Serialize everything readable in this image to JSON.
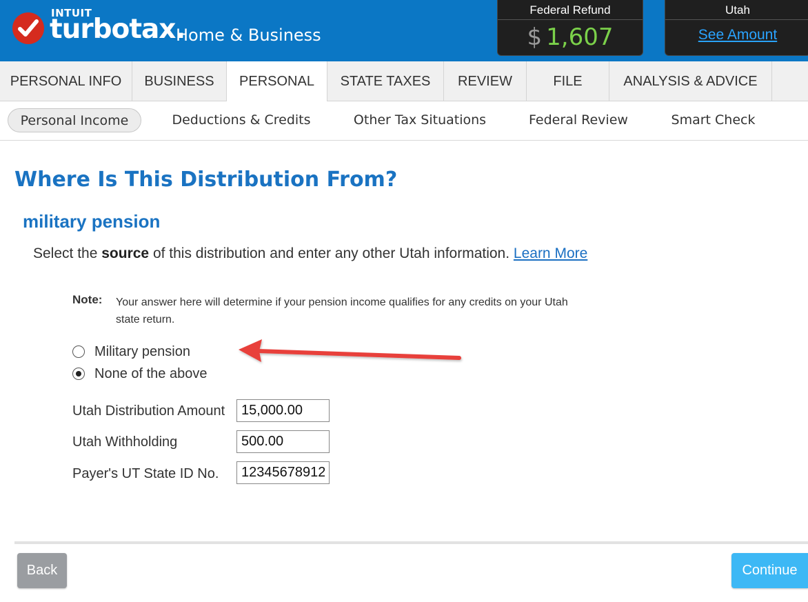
{
  "header": {
    "brand_top": "INTUIT",
    "brand_name": "turbotax.",
    "edition": "Home & Business",
    "federal_refund": {
      "label": "Federal Refund",
      "currency": "$",
      "amount": "1,607"
    },
    "state": {
      "label": "Utah",
      "link": "See Amount"
    }
  },
  "main_nav": {
    "tabs": [
      {
        "label": "PERSONAL INFO",
        "active": false
      },
      {
        "label": "BUSINESS",
        "active": false
      },
      {
        "label": "PERSONAL",
        "active": true
      },
      {
        "label": "STATE TAXES",
        "active": false
      },
      {
        "label": "REVIEW",
        "active": false
      },
      {
        "label": "FILE",
        "active": false
      },
      {
        "label": "ANALYSIS & ADVICE",
        "active": false
      }
    ]
  },
  "sub_nav": {
    "items": [
      {
        "label": "Personal Income",
        "active": true
      },
      {
        "label": "Deductions & Credits",
        "active": false
      },
      {
        "label": "Other Tax Situations",
        "active": false
      },
      {
        "label": "Federal Review",
        "active": false
      },
      {
        "label": "Smart Check",
        "active": false
      }
    ]
  },
  "content": {
    "title": "Where Is This Distribution From?",
    "subtitle": "military pension",
    "instruction_pre": "Select the ",
    "instruction_bold": "source",
    "instruction_post": " of this distribution and enter any other Utah information. ",
    "learn_more": "Learn More",
    "note_label": "Note:",
    "note_text": "Your answer here will determine if your pension income qualifies for any credits on your Utah state return.",
    "options": [
      {
        "label": "Military pension",
        "checked": false
      },
      {
        "label": "None of the above",
        "checked": true
      }
    ],
    "fields": [
      {
        "label": "Utah Distribution Amount",
        "value": "15,000.00"
      },
      {
        "label": "Utah Withholding",
        "value": "500.00"
      },
      {
        "label": "Payer's UT State ID No.",
        "value": "12345678912"
      }
    ]
  },
  "footer": {
    "back_label": "Back",
    "continue_label": "Continue"
  },
  "colors": {
    "header_bg": "#0b77c5",
    "logo_red": "#d52b1e",
    "refund_green": "#7bd14a",
    "title_blue": "#1a73c2",
    "annotation_arrow": "#e8403b",
    "continue_button": "#3db8f5",
    "back_button": "#9a9da1"
  }
}
